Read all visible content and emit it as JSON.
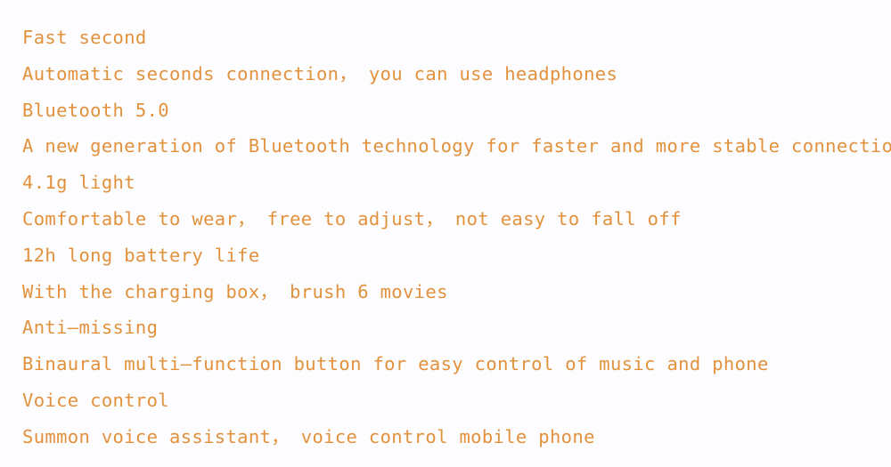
{
  "theme": {
    "text_color": "#e2913d",
    "background_color": "#fdfdff"
  },
  "feature_list": {
    "lines": [
      {
        "role": "title",
        "text": "Fast second"
      },
      {
        "role": "description",
        "text": "Automatic seconds connection， you can use headphones"
      },
      {
        "role": "title",
        "text": "Bluetooth 5.0"
      },
      {
        "role": "description",
        "text": "A new generation of Bluetooth technology for faster and more stable connections"
      },
      {
        "role": "title",
        "text": "4.1g light"
      },
      {
        "role": "description",
        "text": "Comfortable to wear， free to adjust， not easy to fall off"
      },
      {
        "role": "title",
        "text": "12h long battery life"
      },
      {
        "role": "description",
        "text": "With the charging box， brush 6 movies"
      },
      {
        "role": "title",
        "text": "Anti—missing"
      },
      {
        "role": "description",
        "text": "Binaural multi—function button for easy control of music and phone"
      },
      {
        "role": "title",
        "text": "Voice control"
      },
      {
        "role": "description",
        "text": "Summon voice assistant， voice control mobile phone"
      }
    ]
  }
}
